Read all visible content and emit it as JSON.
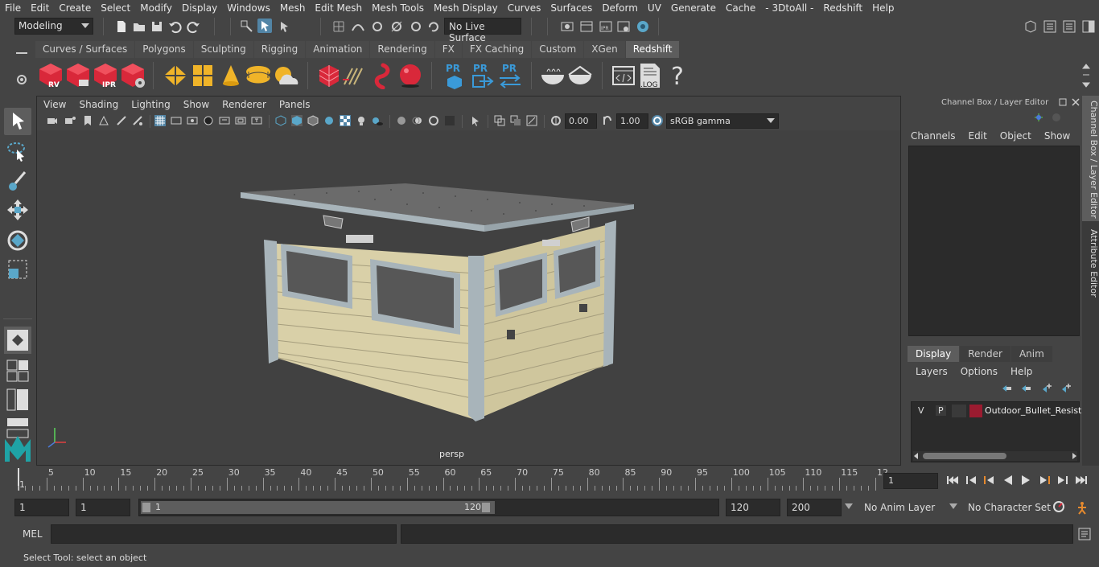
{
  "menubar": {
    "items": [
      "File",
      "Edit",
      "Create",
      "Select",
      "Modify",
      "Display",
      "Windows",
      "Mesh",
      "Edit Mesh",
      "Mesh Tools",
      "Mesh Display",
      "Curves",
      "Surfaces",
      "Deform",
      "UV",
      "Generate",
      "Cache",
      "- 3DtoAll -",
      "Redshift",
      "Help"
    ]
  },
  "statusline": {
    "workspace": "Modeling",
    "live_surface": "No Live Surface"
  },
  "shelf": {
    "tabs": [
      "Curves / Surfaces",
      "Polygons",
      "Sculpting",
      "Rigging",
      "Animation",
      "Rendering",
      "FX",
      "FX Caching",
      "Custom",
      "XGen",
      "Redshift"
    ],
    "active_tab": "Redshift",
    "icon_labels": {
      "rv": "RV",
      "ipr": "IPR",
      "pr1": "PR",
      "pr2": "PR",
      "pr3": "PR",
      "log": ".LOG",
      "help": "?"
    }
  },
  "viewport": {
    "menu": [
      "View",
      "Shading",
      "Lighting",
      "Show",
      "Renderer",
      "Panels"
    ],
    "exposure": "0.00",
    "gamma": "1.00",
    "color_space": "sRGB gamma",
    "camera_label": "persp"
  },
  "channel_box": {
    "title": "Channel Box / Layer Editor",
    "menu": [
      "Channels",
      "Edit",
      "Object",
      "Show"
    ],
    "layer_tabs": [
      "Display",
      "Render",
      "Anim"
    ],
    "active_layer_tab": "Display",
    "layer_menu": [
      "Layers",
      "Options",
      "Help"
    ],
    "layer": {
      "v": "V",
      "p": "P",
      "name": "Outdoor_Bullet_Resist",
      "color": "#9b1b30"
    }
  },
  "side_tabs": [
    "Channel Box / Layer Editor",
    "Attribute Editor"
  ],
  "timeline": {
    "ticks": [
      "5",
      "10",
      "15",
      "20",
      "25",
      "30",
      "35",
      "40",
      "45",
      "50",
      "55",
      "60",
      "65",
      "70",
      "75",
      "80",
      "85",
      "90",
      "95",
      "100",
      "105",
      "110",
      "115",
      "12"
    ],
    "start_label": "1",
    "current_frame": "1"
  },
  "range": {
    "start": "1",
    "playback_start": "1",
    "slider_start": "1",
    "slider_end": "120",
    "playback_end": "120",
    "end": "200",
    "anim_layer": "No Anim Layer",
    "character_set": "No Character Set"
  },
  "cmdline": {
    "label": "MEL"
  },
  "helpline": {
    "text": "Select Tool: select an object"
  },
  "colors": {
    "accent": "#5285a6",
    "redshift_red": "#d9283a",
    "maya_teal": "#1fa3a6"
  }
}
